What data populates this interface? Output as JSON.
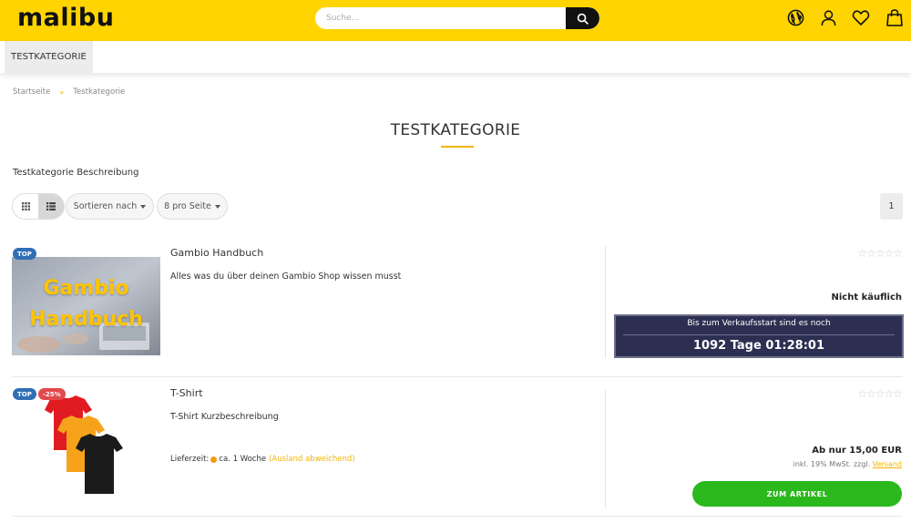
{
  "header": {
    "logo": "malibu",
    "search_placeholder": "Suche...",
    "icons": [
      "globe-icon",
      "user-icon",
      "heart-icon",
      "bag-icon"
    ],
    "accent_color": "#ffd400"
  },
  "nav": {
    "items": [
      {
        "label": "TESTKATEGORIE"
      }
    ]
  },
  "breadcrumb": {
    "home": "Startseite",
    "separator": "»",
    "current": "Testkategorie"
  },
  "page": {
    "title": "TESTKATEGORIE",
    "description": "Testkategorie Beschreibung"
  },
  "toolbar": {
    "sort_label": "Sortieren nach",
    "per_page_label": "8 pro Seite",
    "page_number": "1"
  },
  "products": [
    {
      "name": "Gambio Handbuch",
      "description": "Alles was du über deinen Gambio Shop wissen musst",
      "badges": [
        "TOP"
      ],
      "image_text": [
        "Gambio",
        "Handbuch"
      ],
      "rating": "☆☆☆☆☆",
      "status": "Nicht käuflich",
      "countdown_label": "Bis zum Verkaufsstart sind es noch",
      "countdown_value": "1092 Tage 01:28:01"
    },
    {
      "name": "T-Shirt",
      "description": "T-Shirt Kurzbeschreibung",
      "badges": [
        "TOP",
        "-25%"
      ],
      "rating": "☆☆☆☆☆",
      "delivery_label": "Lieferzeit:",
      "delivery_time": "ca. 1 Woche",
      "delivery_abroad": "(Ausland abweichend)",
      "price": "Ab nur 15,00 EUR",
      "tax_note": "inkl. 19% MwSt. zzgl.",
      "shipping_link": "Versand",
      "cta_label": "ZUM ARTIKEL"
    }
  ]
}
